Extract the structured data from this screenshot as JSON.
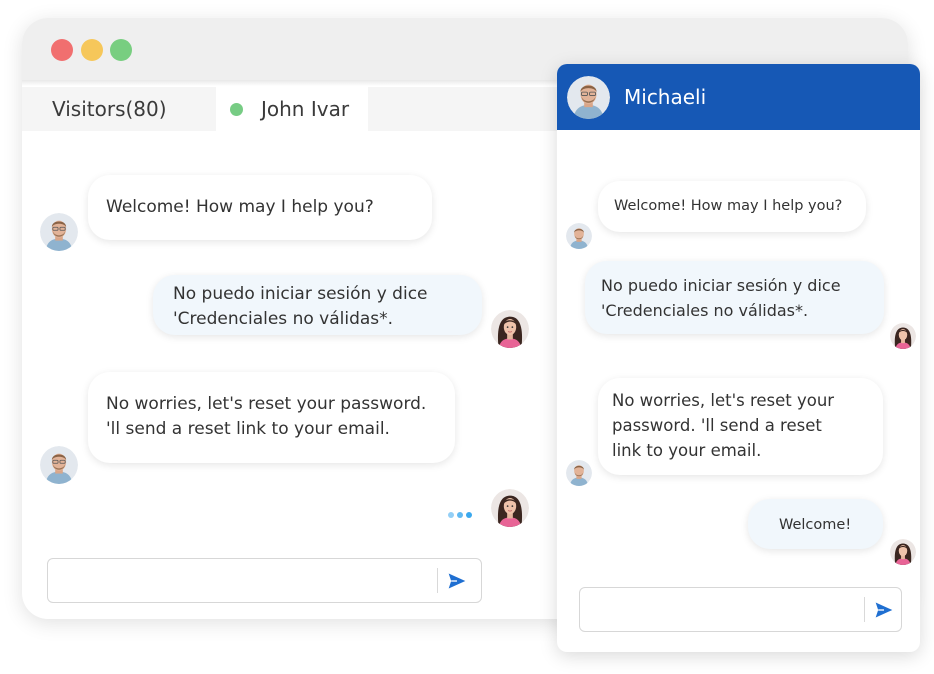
{
  "left_window": {
    "tabs": {
      "visitors_label": "Visitors(80)",
      "active_visitor_name": "John Ivar"
    },
    "messages": [
      {
        "sender": "agent",
        "lines": [
          "Welcome! How may I help you?"
        ]
      },
      {
        "sender": "visitor",
        "lines": [
          "No puedo iniciar sesión y dice",
          "'Credenciales no válidas*."
        ]
      },
      {
        "sender": "agent",
        "lines": [
          "No worries, let's reset your password.",
          "'ll send a reset link to your email."
        ]
      }
    ],
    "typing_indicator": "visitor-typing",
    "input": {
      "value": "",
      "placeholder": ""
    }
  },
  "right_window": {
    "header": {
      "name": "Michaeli"
    },
    "messages": [
      {
        "sender": "agent",
        "lines": [
          "Welcome! How may I help you?"
        ]
      },
      {
        "sender": "visitor",
        "lines": [
          "No puedo iniciar sesión y dice",
          "'Credenciales no válidas*."
        ]
      },
      {
        "sender": "agent",
        "lines": [
          "No worries, let's reset your",
          "password. 'll send a reset",
          "link to your email."
        ]
      },
      {
        "sender": "visitor",
        "lines": [
          "Welcome!"
        ]
      }
    ],
    "input": {
      "value": "",
      "placeholder": ""
    }
  },
  "colors": {
    "header_blue": "#1658b5",
    "send_blue": "#1f6fd1",
    "online_green": "#77cc84",
    "typing_blue": "#3aa8ee",
    "traffic_red": "#f16f6f",
    "traffic_yellow": "#f6c75a",
    "traffic_green": "#78ce80"
  },
  "icons": [
    "close-dot",
    "minimize-dot",
    "maximize-dot",
    "online-status-dot",
    "send-icon",
    "agent-avatar",
    "visitor-avatar"
  ]
}
